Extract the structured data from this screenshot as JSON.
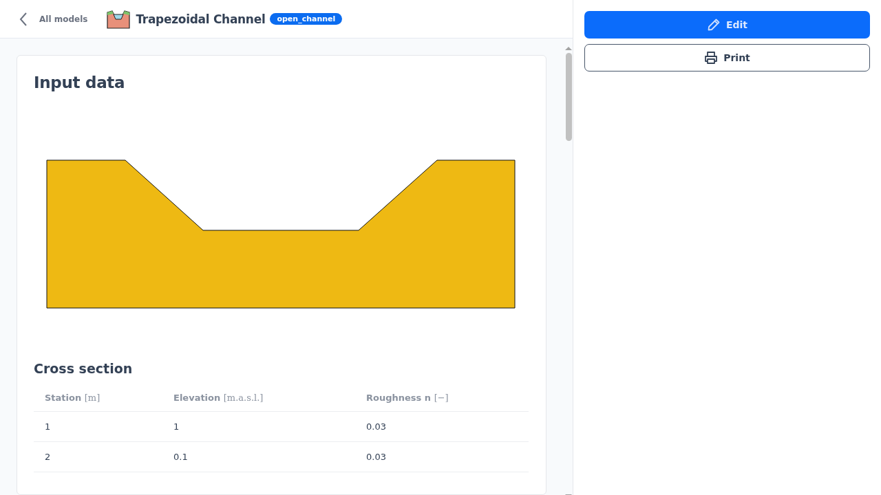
{
  "header": {
    "back_label": "All models",
    "title": "Trapezoidal Channel",
    "tag": "open_channel"
  },
  "input_section": {
    "title": "Input data"
  },
  "cross_section": {
    "title": "Cross section",
    "columns": [
      {
        "label": "Station",
        "unit": "[m]"
      },
      {
        "label": "Elevation",
        "unit": "[m.a.s.l.]"
      },
      {
        "label": "Roughness n",
        "unit": "[−]"
      }
    ],
    "rows": [
      [
        "1",
        "1",
        "0.03"
      ],
      [
        "2",
        "0.1",
        "0.03"
      ]
    ]
  },
  "actions": [
    {
      "kind": "edit",
      "label": "Edit"
    },
    {
      "kind": "print",
      "label": "Print"
    }
  ]
}
